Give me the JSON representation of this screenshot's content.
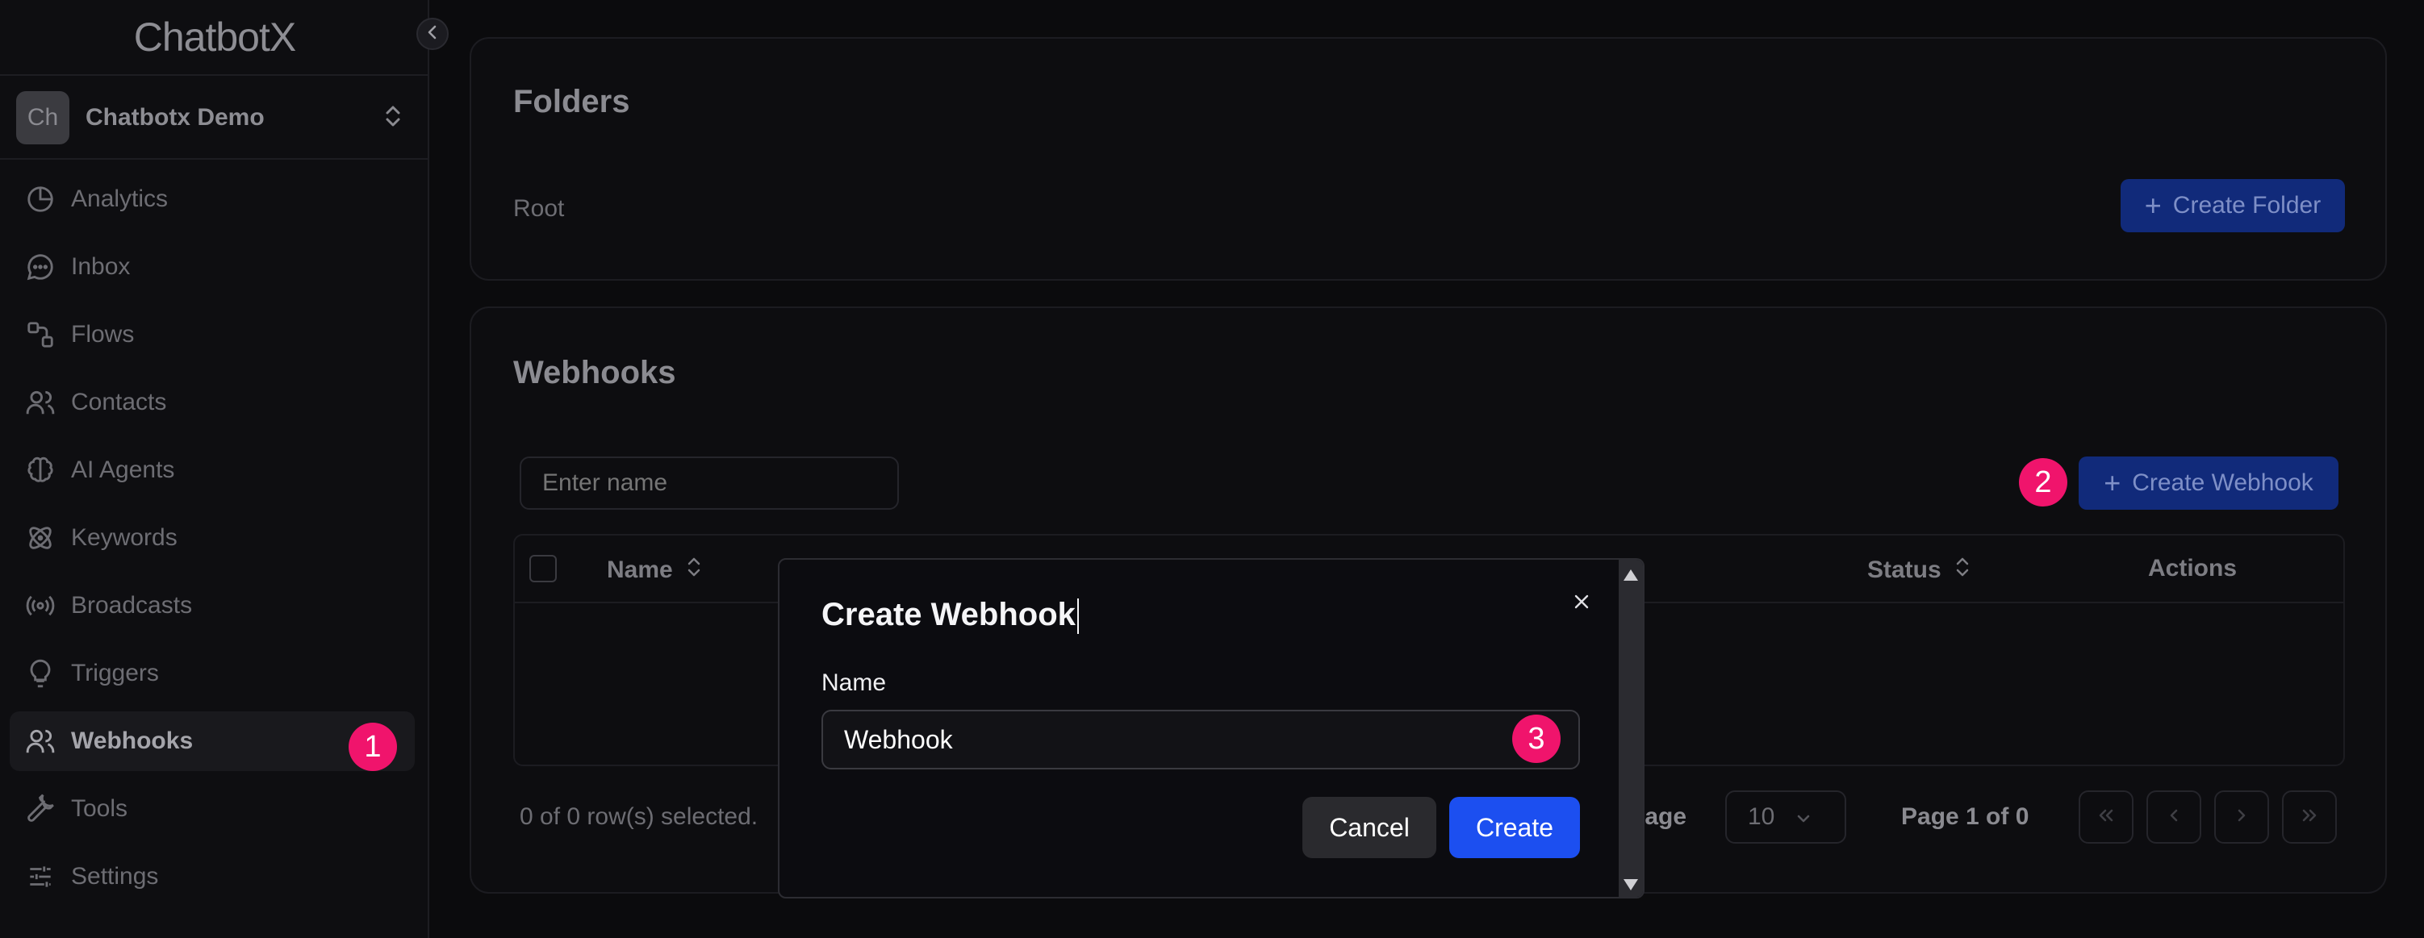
{
  "app": {
    "logo_text": "ChatbotX",
    "workspace": {
      "initials": "Ch",
      "name": "Chatbotx Demo"
    }
  },
  "sidebar": {
    "items": [
      {
        "label": "Analytics",
        "icon": "pie-chart-icon"
      },
      {
        "label": "Inbox",
        "icon": "message-circle-icon"
      },
      {
        "label": "Flows",
        "icon": "flow-icon"
      },
      {
        "label": "Contacts",
        "icon": "users-icon"
      },
      {
        "label": "AI Agents",
        "icon": "brain-icon"
      },
      {
        "label": "Keywords",
        "icon": "atom-icon"
      },
      {
        "label": "Broadcasts",
        "icon": "broadcast-icon"
      },
      {
        "label": "Triggers",
        "icon": "lightbulb-icon"
      },
      {
        "label": "Webhooks",
        "icon": "users-icon",
        "active": true
      },
      {
        "label": "Tools",
        "icon": "wrench-icon"
      },
      {
        "label": "Settings",
        "icon": "sliders-icon"
      }
    ]
  },
  "markers": {
    "one": "1",
    "two": "2",
    "three": "3"
  },
  "folders": {
    "title": "Folders",
    "root_label": "Root",
    "create_button": "Create Folder"
  },
  "webhooks": {
    "title": "Webhooks",
    "search_placeholder": "Enter name",
    "create_button": "Create Webhook",
    "columns": {
      "name": "Name",
      "status": "Status",
      "actions": "Actions"
    },
    "selection_text": "0 of 0 row(s) selected.",
    "rows_per_page_label": "r page",
    "rows_per_page_value": "10",
    "page_text": "Page 1 of 0"
  },
  "modal": {
    "title": "Create Webhook",
    "name_label": "Name",
    "name_value": "Webhook",
    "cancel_label": "Cancel",
    "create_label": "Create"
  },
  "colors": {
    "accent_blue": "#1c4ff0",
    "marker_pink": "#f0146c",
    "background": "#0b0b0d"
  }
}
